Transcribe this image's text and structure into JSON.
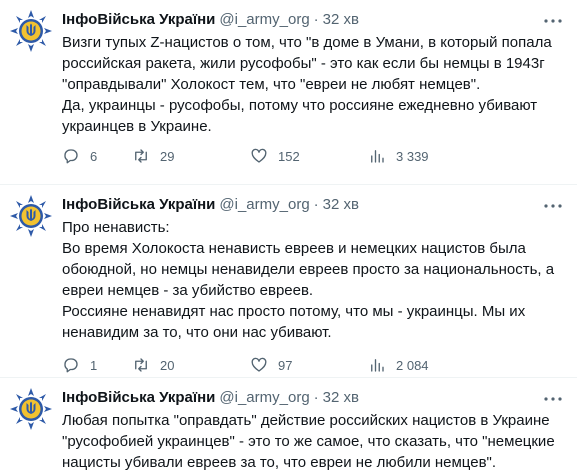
{
  "tweets": [
    {
      "author": "ІнфоВійська України",
      "handle": "@i_army_org",
      "separator": "·",
      "time": "32 хв",
      "lines": [
        "Визги тупых Z-нацистов о том, что \"в  доме в Умани, в который попала",
        "российская ракета, жили русофобы\" - это как если бы немцы в 1943г",
        "\"оправдывали\" Холокост тем, что \"евреи не любят немцев\".",
        "Да, украинцы - русофобы, потому что россияне ежедневно убивают",
        "украинцев в Украине."
      ],
      "replies": "6",
      "retweets": "29",
      "likes": "152",
      "views": "3 339"
    },
    {
      "author": "ІнфоВійська України",
      "handle": "@i_army_org",
      "separator": "·",
      "time": "32 хв",
      "lines": [
        "Про ненависть:",
        "Во время Холокоста ненависть евреев и немецких нацистов была",
        "обоюдной, но немцы ненавидели евреев просто за национальность, а",
        "евреи немцев - за убийство евреев.",
        "Россияне ненавидят нас просто потому, что мы - украинцы. Мы их",
        "ненавидим за то, что они нас убивают."
      ],
      "replies": "1",
      "retweets": "20",
      "likes": "97",
      "views": "2 084"
    },
    {
      "author": "ІнфоВійська України",
      "handle": "@i_army_org",
      "separator": "·",
      "time": "32 хв",
      "lines": [
        "Любая попытка \"оправдать\" действие российских нацистов в Украине",
        "\"русофобией украинцев\" - это то же самое, что сказать, что \"немецкие",
        "нацисты убивали евреев за то, что евреи не любили немцев\"."
      ]
    }
  ],
  "icons": {
    "avatar": "ukraine-trident-emblem-icon",
    "more": "more-dots-icon",
    "reply": "reply-bubble-icon",
    "retweet": "retweet-icon",
    "like": "heart-icon",
    "views": "views-chart-icon"
  },
  "colors": {
    "text": "#0f1419",
    "secondary": "#536471",
    "emblem_blue": "#2e5aa8",
    "divider": "#eff3f4"
  }
}
